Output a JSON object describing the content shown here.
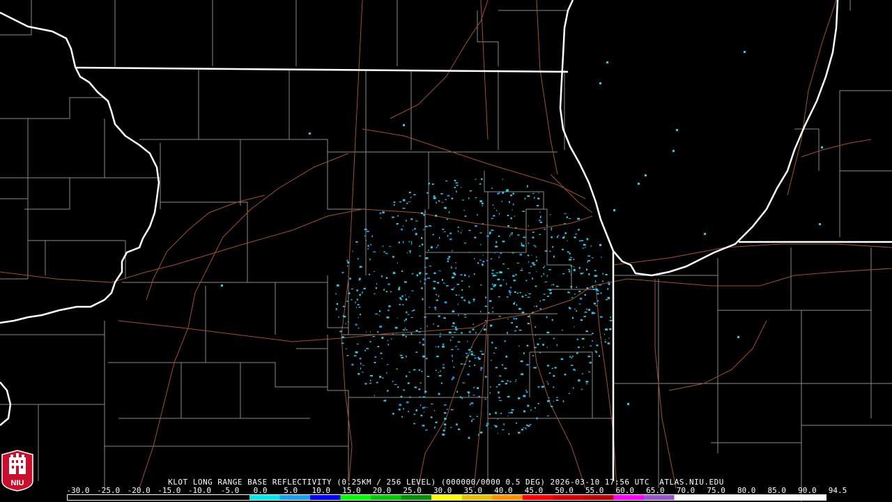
{
  "product_title": "KLOT LONG RANGE BASE REFLECTIVITY (0.25KM / 256 LEVEL) (000000/0000 0.5 DEG) 2026-03-10 17:56 UTC  ATLAS.NIU.EDU",
  "logo_text": "NIU",
  "colors": {
    "background": "#000000",
    "state_border": "#ffffff",
    "county_line": "#8a8a8a",
    "highway": "#a0522d",
    "echo_light": "#33c8e8",
    "echo_medium": "#2a8fe0"
  },
  "scale": {
    "labels": [
      "-30.0",
      "-25.0",
      "-20.0",
      "-15.0",
      "-10.0",
      "-5.0",
      "0.0",
      "5.0",
      "10.0",
      "15.0",
      "20.0",
      "25.0",
      "30.0",
      "35.0",
      "40.0",
      "45.0",
      "50.0",
      "55.0",
      "60.0",
      "65.0",
      "70.0",
      "75.0",
      "80.0",
      "85.0",
      "90.0",
      "94.5"
    ],
    "colors": [
      "#000000",
      "#000000",
      "#000000",
      "#000000",
      "#000000",
      "#000000",
      "#00e8e8",
      "#1ea0f0",
      "#0000f6",
      "#00ff00",
      "#00c800",
      "#009000",
      "#ffff00",
      "#e7c000",
      "#ff9000",
      "#ff0000",
      "#d60000",
      "#c00000",
      "#ff00ff",
      "#9955c9",
      "#ffffff",
      "#ffffff",
      "#ffffff",
      "#ffffff",
      "#ffffff"
    ]
  }
}
